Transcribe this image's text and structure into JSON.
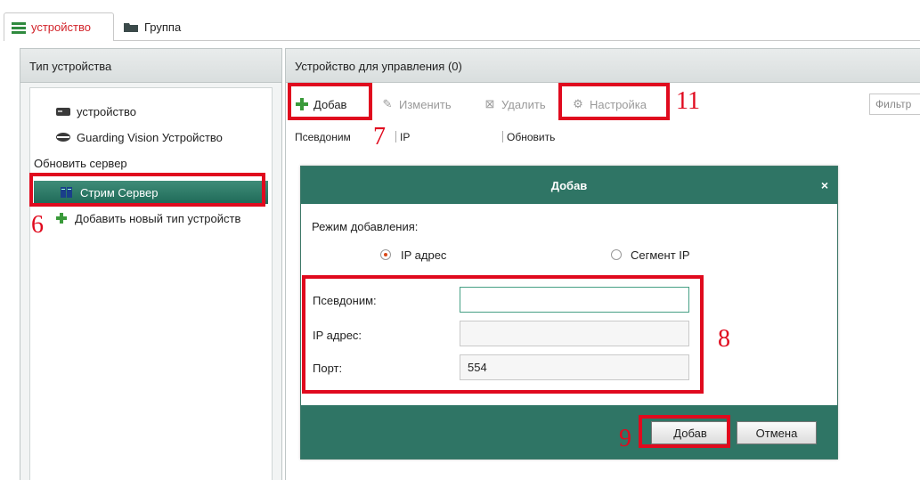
{
  "top_tabs": [
    {
      "label": "устройство",
      "icon": "device-list-icon",
      "active": true
    },
    {
      "label": "Группа",
      "icon": "group-icon",
      "active": false
    }
  ],
  "left_panel": {
    "title": "Тип устройства",
    "items": [
      {
        "label": "устройство",
        "icon": "device-icon"
      },
      {
        "label": "Guarding Vision Устройство",
        "icon": "cloud-device-icon"
      },
      {
        "label": "Обновить сервер",
        "icon": ""
      },
      {
        "label": "Стрим Сервер",
        "icon": "stream-server-icon",
        "selected": true
      },
      {
        "label": "Добавить новый тип устройств",
        "icon": "plus-icon"
      }
    ]
  },
  "right_panel": {
    "title": "Устройство для управления (0)",
    "toolbar": {
      "add": "Добав",
      "edit": "Изменить",
      "delete": "Удалить",
      "settings": "Настройка",
      "filter_placeholder": "Фильтр"
    },
    "columns": [
      "Псевдоним",
      "IP",
      "Обновить"
    ]
  },
  "dialog": {
    "title": "Добав",
    "close": "×",
    "mode_label": "Режим добавления:",
    "modes": [
      {
        "label": "IP адрес",
        "checked": true
      },
      {
        "label": "Сегмент IP",
        "checked": false
      }
    ],
    "fields": [
      {
        "label": "Псевдоним:",
        "value": ""
      },
      {
        "label": "IP адрес:",
        "value": ""
      },
      {
        "label": "Порт:",
        "value": "554"
      }
    ],
    "ok": "Добав",
    "cancel": "Отмена"
  },
  "annotations": [
    "6",
    "7",
    "8",
    "9",
    "11"
  ],
  "colors": {
    "accent_red": "#e00a1e",
    "dialog_green": "#2f7565",
    "tab_active_text": "#d2232a",
    "add_green": "#3a9a3a"
  }
}
